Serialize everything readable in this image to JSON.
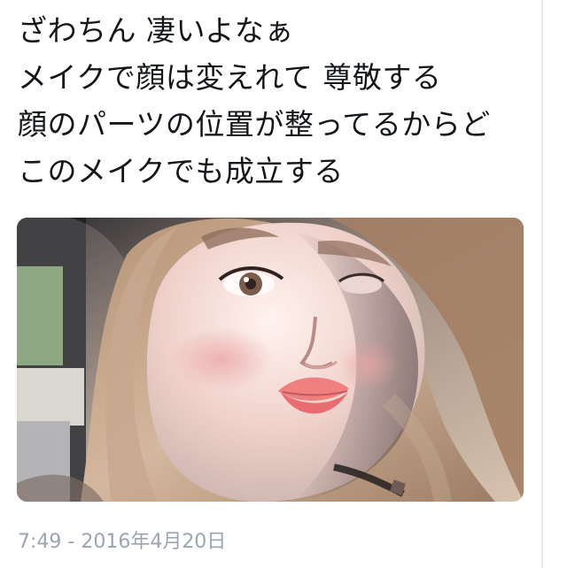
{
  "tweet": {
    "lines": [
      "ざわちん 凄いよなぁ",
      "メイクで顔は変えれて 尊敬する",
      "顔のパーツの位置が整ってるからど",
      "このメイクでも成立する"
    ],
    "timestamp": "7:49 - 2016年4月20日"
  },
  "media": {
    "icon": "photo-image"
  },
  "colors": {
    "text": "#14171a",
    "timestamp": "#9aa5b1",
    "divider": "#e6e9ec",
    "background": "#ffffff"
  }
}
